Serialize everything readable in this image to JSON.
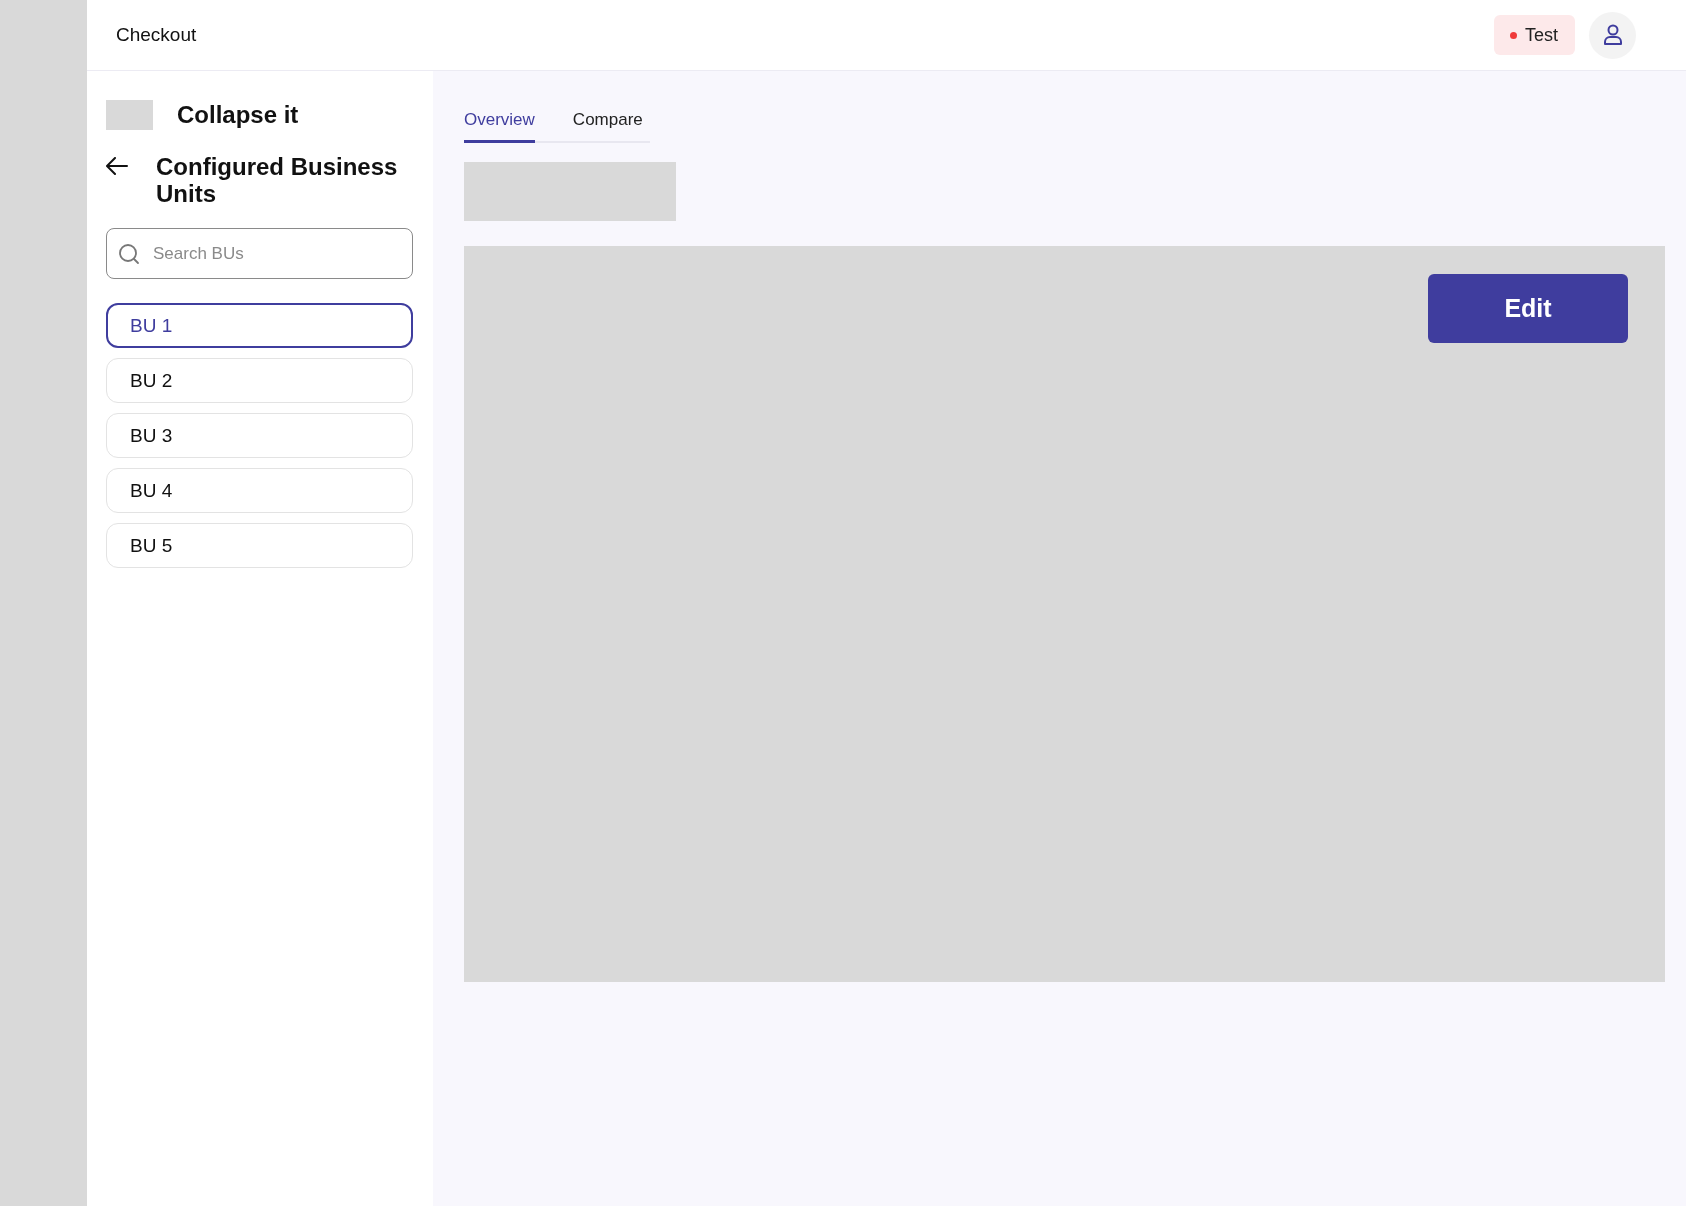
{
  "header": {
    "title": "Checkout",
    "environment_badge": {
      "label": "Test",
      "color": "#f03a3a"
    }
  },
  "sidebar": {
    "collapse_label": "Collapse it",
    "heading": "Configured Business Units",
    "search": {
      "placeholder": "Search BUs"
    },
    "items": [
      {
        "label": "BU 1",
        "selected": true
      },
      {
        "label": "BU 2",
        "selected": false
      },
      {
        "label": "BU 3",
        "selected": false
      },
      {
        "label": "BU 4",
        "selected": false
      },
      {
        "label": "BU 5",
        "selected": false
      }
    ]
  },
  "tabs": [
    {
      "label": "Overview",
      "selected": true
    },
    {
      "label": "Compare",
      "selected": false
    }
  ],
  "panel": {
    "edit_button": "Edit"
  }
}
